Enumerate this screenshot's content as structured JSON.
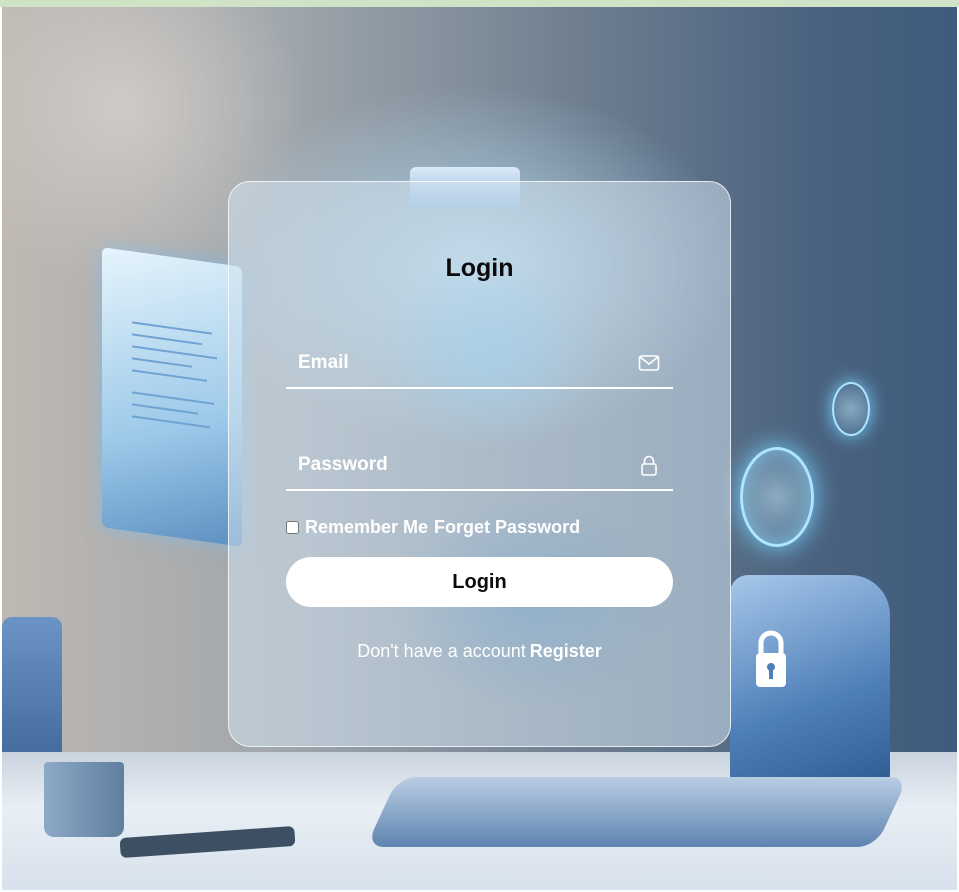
{
  "login": {
    "title": "Login",
    "email_placeholder": "Email",
    "password_placeholder": "Password",
    "remember_label": "Remember Me",
    "forget_label": "Forget Password",
    "login_button": "Login",
    "no_account_text": "Don't have a account",
    "register_link": "Register"
  },
  "icons": {
    "email": "mail-icon",
    "password": "lock-icon"
  },
  "colors": {
    "accent": "#ffffff",
    "title": "#0b0b0b"
  }
}
